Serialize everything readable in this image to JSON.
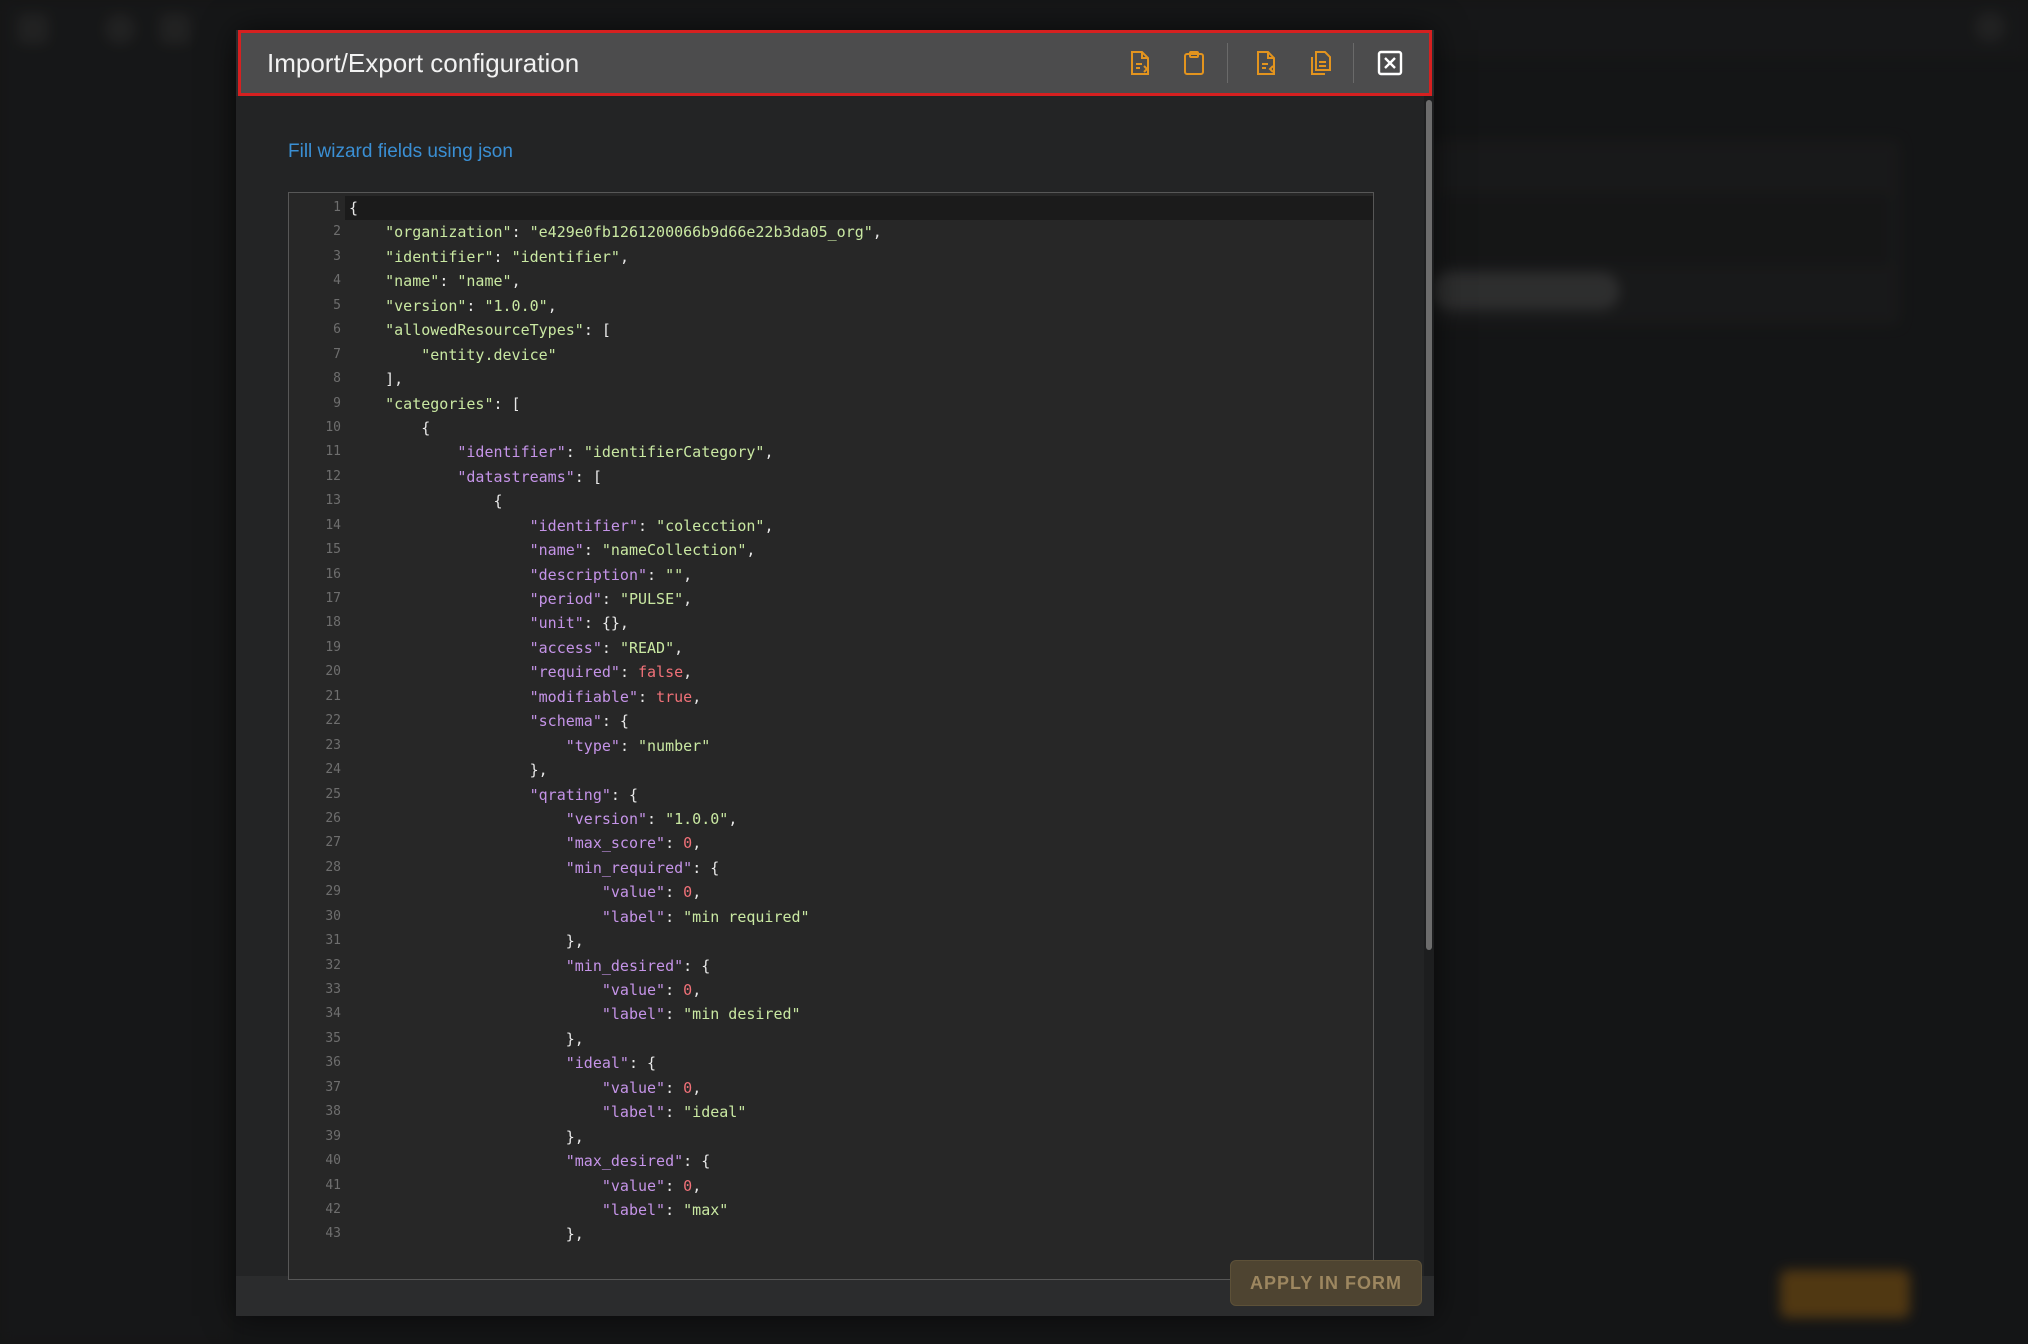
{
  "modal": {
    "title": "Import/Export configuration",
    "hint": "Fill wizard fields using json",
    "apply_label": "APPLY IN FORM",
    "accent_color": "#e3941e",
    "header_border_color": "#d62020",
    "toolbar_icons": [
      "file-export-icon",
      "clipboard-icon",
      "file-import-icon",
      "copy-icon",
      "close-icon"
    ]
  },
  "editor": {
    "lines": [
      [
        {
          "t": "p",
          "v": "{"
        }
      ],
      [
        {
          "t": "p",
          "v": "    "
        },
        {
          "t": "s",
          "v": "\"organization\""
        },
        {
          "t": "p",
          "v": ": "
        },
        {
          "t": "s",
          "v": "\"e429e0fb1261200066b9d66e22b3da05_org\""
        },
        {
          "t": "p",
          "v": ","
        }
      ],
      [
        {
          "t": "p",
          "v": "    "
        },
        {
          "t": "s",
          "v": "\"identifier\""
        },
        {
          "t": "p",
          "v": ": "
        },
        {
          "t": "s",
          "v": "\"identifier\""
        },
        {
          "t": "p",
          "v": ","
        }
      ],
      [
        {
          "t": "p",
          "v": "    "
        },
        {
          "t": "s",
          "v": "\"name\""
        },
        {
          "t": "p",
          "v": ": "
        },
        {
          "t": "s",
          "v": "\"name\""
        },
        {
          "t": "p",
          "v": ","
        }
      ],
      [
        {
          "t": "p",
          "v": "    "
        },
        {
          "t": "s",
          "v": "\"version\""
        },
        {
          "t": "p",
          "v": ": "
        },
        {
          "t": "s",
          "v": "\"1.0.0\""
        },
        {
          "t": "p",
          "v": ","
        }
      ],
      [
        {
          "t": "p",
          "v": "    "
        },
        {
          "t": "s",
          "v": "\"allowedResourceTypes\""
        },
        {
          "t": "p",
          "v": ": ["
        }
      ],
      [
        {
          "t": "p",
          "v": "        "
        },
        {
          "t": "s",
          "v": "\"entity.device\""
        }
      ],
      [
        {
          "t": "p",
          "v": "    ],"
        }
      ],
      [
        {
          "t": "p",
          "v": "    "
        },
        {
          "t": "s",
          "v": "\"categories\""
        },
        {
          "t": "p",
          "v": ": ["
        }
      ],
      [
        {
          "t": "p",
          "v": "        {"
        }
      ],
      [
        {
          "t": "p",
          "v": "            "
        },
        {
          "t": "k",
          "v": "\"identifier\""
        },
        {
          "t": "p",
          "v": ": "
        },
        {
          "t": "s",
          "v": "\"identifierCategory\""
        },
        {
          "t": "p",
          "v": ","
        }
      ],
      [
        {
          "t": "p",
          "v": "            "
        },
        {
          "t": "k",
          "v": "\"datastreams\""
        },
        {
          "t": "p",
          "v": ": ["
        }
      ],
      [
        {
          "t": "p",
          "v": "                {"
        }
      ],
      [
        {
          "t": "p",
          "v": "                    "
        },
        {
          "t": "k",
          "v": "\"identifier\""
        },
        {
          "t": "p",
          "v": ": "
        },
        {
          "t": "s",
          "v": "\"colecction\""
        },
        {
          "t": "p",
          "v": ","
        }
      ],
      [
        {
          "t": "p",
          "v": "                    "
        },
        {
          "t": "k",
          "v": "\"name\""
        },
        {
          "t": "p",
          "v": ": "
        },
        {
          "t": "s",
          "v": "\"nameCollection\""
        },
        {
          "t": "p",
          "v": ","
        }
      ],
      [
        {
          "t": "p",
          "v": "                    "
        },
        {
          "t": "k",
          "v": "\"description\""
        },
        {
          "t": "p",
          "v": ": "
        },
        {
          "t": "s",
          "v": "\"\""
        },
        {
          "t": "p",
          "v": ","
        }
      ],
      [
        {
          "t": "p",
          "v": "                    "
        },
        {
          "t": "k",
          "v": "\"period\""
        },
        {
          "t": "p",
          "v": ": "
        },
        {
          "t": "s",
          "v": "\"PULSE\""
        },
        {
          "t": "p",
          "v": ","
        }
      ],
      [
        {
          "t": "p",
          "v": "                    "
        },
        {
          "t": "k",
          "v": "\"unit\""
        },
        {
          "t": "p",
          "v": ": {},"
        }
      ],
      [
        {
          "t": "p",
          "v": "                    "
        },
        {
          "t": "k",
          "v": "\"access\""
        },
        {
          "t": "p",
          "v": ": "
        },
        {
          "t": "s",
          "v": "\"READ\""
        },
        {
          "t": "p",
          "v": ","
        }
      ],
      [
        {
          "t": "p",
          "v": "                    "
        },
        {
          "t": "k",
          "v": "\"required\""
        },
        {
          "t": "p",
          "v": ": "
        },
        {
          "t": "b",
          "v": "false"
        },
        {
          "t": "p",
          "v": ","
        }
      ],
      [
        {
          "t": "p",
          "v": "                    "
        },
        {
          "t": "k",
          "v": "\"modifiable\""
        },
        {
          "t": "p",
          "v": ": "
        },
        {
          "t": "b",
          "v": "true"
        },
        {
          "t": "p",
          "v": ","
        }
      ],
      [
        {
          "t": "p",
          "v": "                    "
        },
        {
          "t": "k",
          "v": "\"schema\""
        },
        {
          "t": "p",
          "v": ": {"
        }
      ],
      [
        {
          "t": "p",
          "v": "                        "
        },
        {
          "t": "k",
          "v": "\"type\""
        },
        {
          "t": "p",
          "v": ": "
        },
        {
          "t": "s",
          "v": "\"number\""
        }
      ],
      [
        {
          "t": "p",
          "v": "                    },"
        }
      ],
      [
        {
          "t": "p",
          "v": "                    "
        },
        {
          "t": "k",
          "v": "\"qrating\""
        },
        {
          "t": "p",
          "v": ": {"
        }
      ],
      [
        {
          "t": "p",
          "v": "                        "
        },
        {
          "t": "k",
          "v": "\"version\""
        },
        {
          "t": "p",
          "v": ": "
        },
        {
          "t": "s",
          "v": "\"1.0.0\""
        },
        {
          "t": "p",
          "v": ","
        }
      ],
      [
        {
          "t": "p",
          "v": "                        "
        },
        {
          "t": "k",
          "v": "\"max_score\""
        },
        {
          "t": "p",
          "v": ": "
        },
        {
          "t": "n",
          "v": "0"
        },
        {
          "t": "p",
          "v": ","
        }
      ],
      [
        {
          "t": "p",
          "v": "                        "
        },
        {
          "t": "k",
          "v": "\"min_required\""
        },
        {
          "t": "p",
          "v": ": {"
        }
      ],
      [
        {
          "t": "p",
          "v": "                            "
        },
        {
          "t": "k",
          "v": "\"value\""
        },
        {
          "t": "p",
          "v": ": "
        },
        {
          "t": "n",
          "v": "0"
        },
        {
          "t": "p",
          "v": ","
        }
      ],
      [
        {
          "t": "p",
          "v": "                            "
        },
        {
          "t": "k",
          "v": "\"label\""
        },
        {
          "t": "p",
          "v": ": "
        },
        {
          "t": "s",
          "v": "\"min required\""
        }
      ],
      [
        {
          "t": "p",
          "v": "                        },"
        }
      ],
      [
        {
          "t": "p",
          "v": "                        "
        },
        {
          "t": "k",
          "v": "\"min_desired\""
        },
        {
          "t": "p",
          "v": ": {"
        }
      ],
      [
        {
          "t": "p",
          "v": "                            "
        },
        {
          "t": "k",
          "v": "\"value\""
        },
        {
          "t": "p",
          "v": ": "
        },
        {
          "t": "n",
          "v": "0"
        },
        {
          "t": "p",
          "v": ","
        }
      ],
      [
        {
          "t": "p",
          "v": "                            "
        },
        {
          "t": "k",
          "v": "\"label\""
        },
        {
          "t": "p",
          "v": ": "
        },
        {
          "t": "s",
          "v": "\"min desired\""
        }
      ],
      [
        {
          "t": "p",
          "v": "                        },"
        }
      ],
      [
        {
          "t": "p",
          "v": "                        "
        },
        {
          "t": "k",
          "v": "\"ideal\""
        },
        {
          "t": "p",
          "v": ": {"
        }
      ],
      [
        {
          "t": "p",
          "v": "                            "
        },
        {
          "t": "k",
          "v": "\"value\""
        },
        {
          "t": "p",
          "v": ": "
        },
        {
          "t": "n",
          "v": "0"
        },
        {
          "t": "p",
          "v": ","
        }
      ],
      [
        {
          "t": "p",
          "v": "                            "
        },
        {
          "t": "k",
          "v": "\"label\""
        },
        {
          "t": "p",
          "v": ": "
        },
        {
          "t": "s",
          "v": "\"ideal\""
        }
      ],
      [
        {
          "t": "p",
          "v": "                        },"
        }
      ],
      [
        {
          "t": "p",
          "v": "                        "
        },
        {
          "t": "k",
          "v": "\"max_desired\""
        },
        {
          "t": "p",
          "v": ": {"
        }
      ],
      [
        {
          "t": "p",
          "v": "                            "
        },
        {
          "t": "k",
          "v": "\"value\""
        },
        {
          "t": "p",
          "v": ": "
        },
        {
          "t": "n",
          "v": "0"
        },
        {
          "t": "p",
          "v": ","
        }
      ],
      [
        {
          "t": "p",
          "v": "                            "
        },
        {
          "t": "k",
          "v": "\"label\""
        },
        {
          "t": "p",
          "v": ": "
        },
        {
          "t": "s",
          "v": "\"max\""
        }
      ],
      [
        {
          "t": "p",
          "v": "                        },"
        }
      ]
    ]
  }
}
